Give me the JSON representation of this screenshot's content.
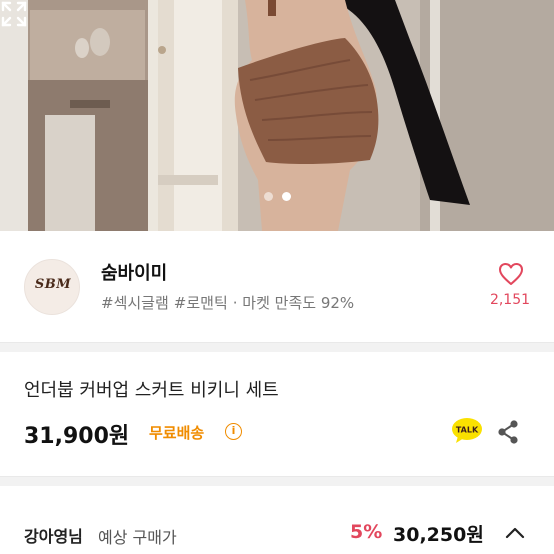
{
  "gallery": {
    "image_description": "product-photo",
    "page_count": 2,
    "current_page": 2
  },
  "seller": {
    "logo_text": "SBM",
    "logo_subtext": "",
    "name": "숨바이미",
    "tags": [
      "#섹시글램",
      "#로맨틱",
      "· 마켓 만족도 92%"
    ],
    "likes": "2,151"
  },
  "product": {
    "title": "언더붑 커버업 스커트 비키니 세트",
    "price": "31,900원",
    "shipping": "무료배송",
    "info_glyph": "i"
  },
  "buyer": {
    "name": "강아영님",
    "label": "예상 구매가",
    "discount": "5%",
    "price": "30,250원"
  },
  "colors": {
    "accent_pink": "#e2475d",
    "shipping_orange": "#f08c00",
    "talk_yellow": "#fae100"
  },
  "icons": {
    "expand": "expand-icon",
    "heart": "heart-icon",
    "talk": "kakao-talk-icon",
    "share": "share-icon",
    "chevron": "chevron-up-icon"
  }
}
